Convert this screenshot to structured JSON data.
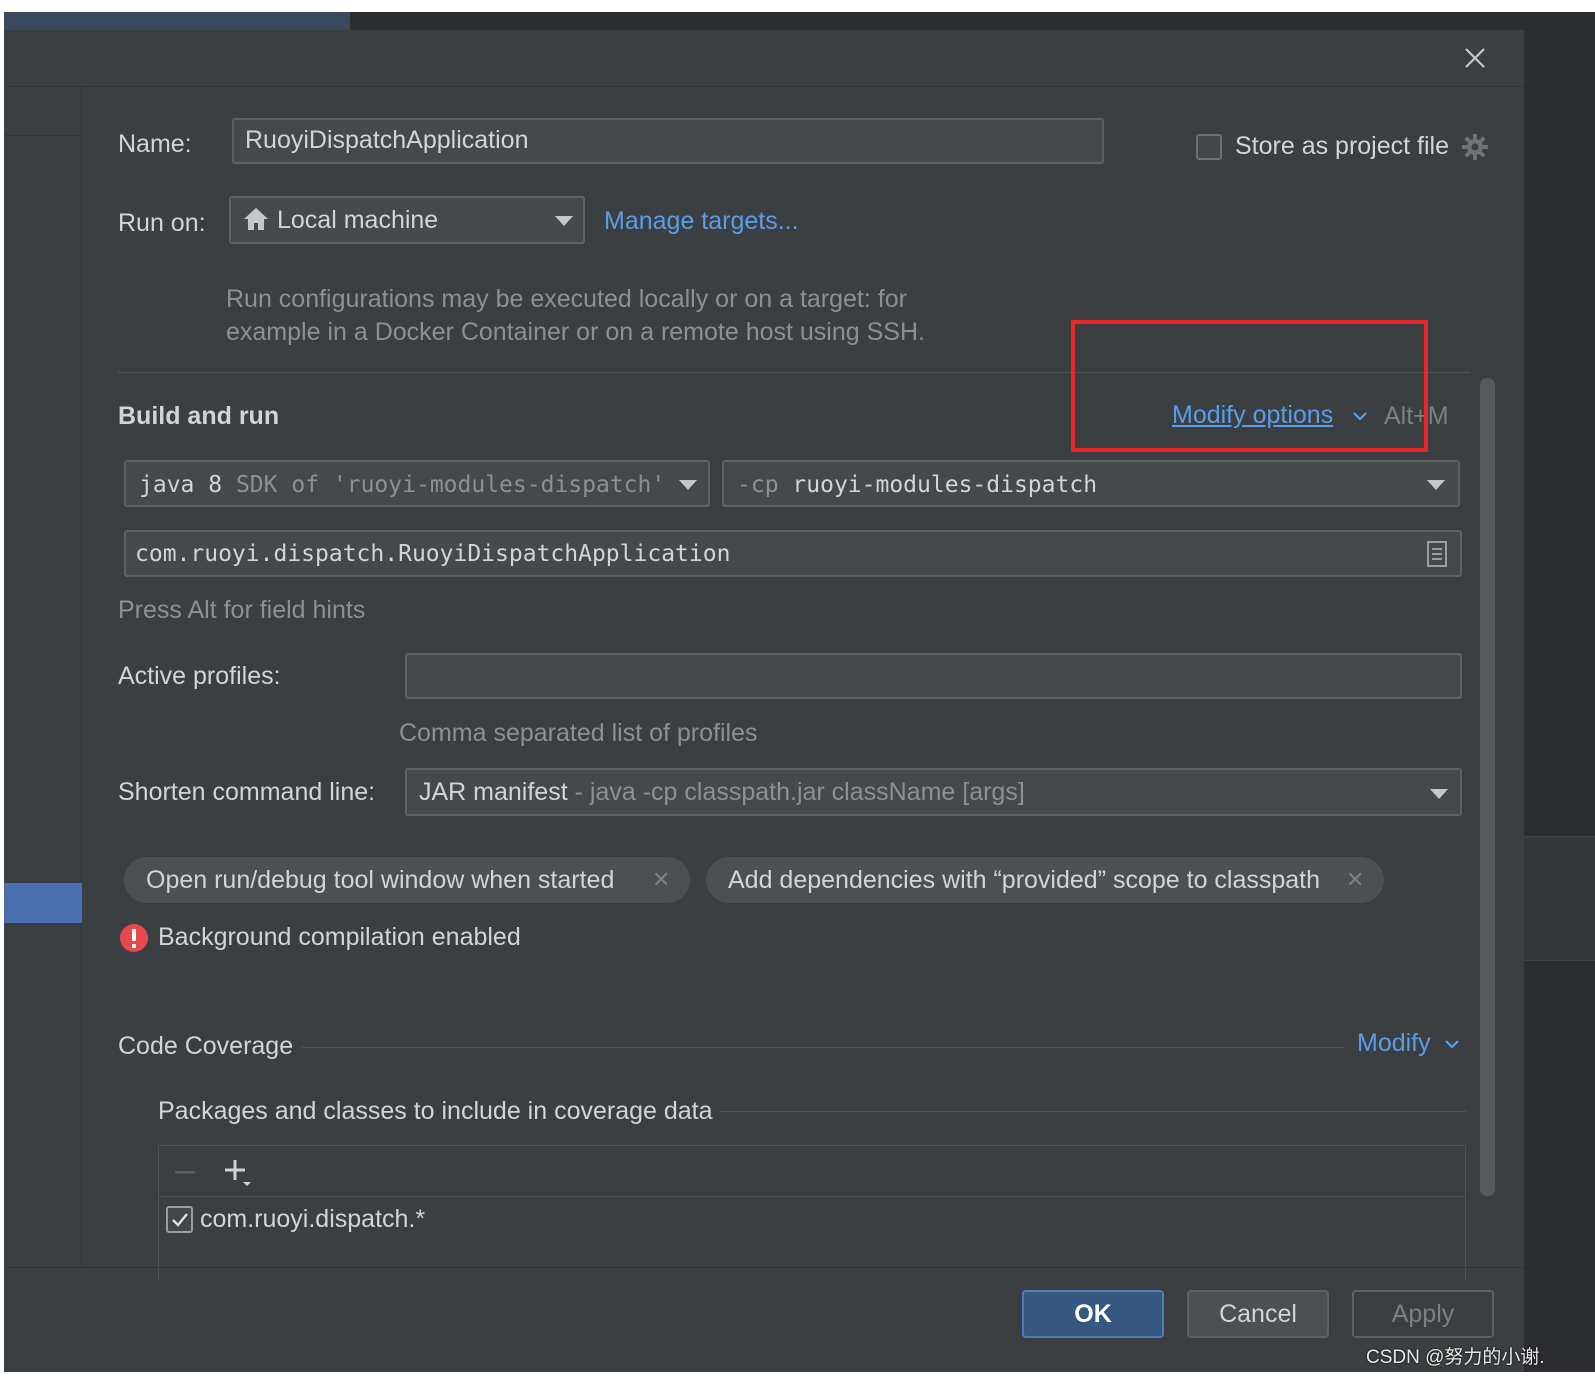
{
  "dialog": {
    "name_label": "Name:",
    "name_value": "RuoyiDispatchApplication",
    "store_label": "Store as project file",
    "run_on_label": "Run on:",
    "run_on_value": "Local machine",
    "manage_targets": "Manage targets...",
    "run_hint_line1": "Run configurations may be executed locally or on a target: for",
    "run_hint_line2": "example in a Docker Container or on a remote host using SSH."
  },
  "build_and_run": {
    "title": "Build and run",
    "modify_options": "Modify options",
    "modify_shortcut": "Alt+M",
    "sdk_main": "java 8",
    "sdk_detail": "SDK of 'ruoyi-modules-dispatch'",
    "cp_flag": "-cp",
    "cp_value": "ruoyi-modules-dispatch",
    "main_class": "com.ruoyi.dispatch.RuoyiDispatchApplication",
    "field_hint": "Press Alt for field hints",
    "active_profiles_label": "Active profiles:",
    "active_profiles_value": "",
    "profiles_hint": "Comma separated list of profiles",
    "shorten_label": "Shorten command line:",
    "shorten_value": "JAR manifest",
    "shorten_detail": "- java -cp classpath.jar className [args]",
    "chips": [
      "Open run/debug tool window when started",
      "Add dependencies with “provided” scope to classpath"
    ],
    "warning": "Background compilation enabled"
  },
  "coverage": {
    "title": "Code Coverage",
    "modify": "Modify",
    "packages_title": "Packages and classes to include in coverage data",
    "items": [
      {
        "label": "com.ruoyi.dispatch.*",
        "checked": true
      }
    ]
  },
  "buttons": {
    "ok": "OK",
    "cancel": "Cancel",
    "apply": "Apply"
  },
  "watermark": "CSDN @努力的小谢.",
  "colors": {
    "accent_link": "#5a9ce8",
    "ok_button": "#365880",
    "highlight_box": "#e8262b",
    "warning": "#e5484d"
  }
}
